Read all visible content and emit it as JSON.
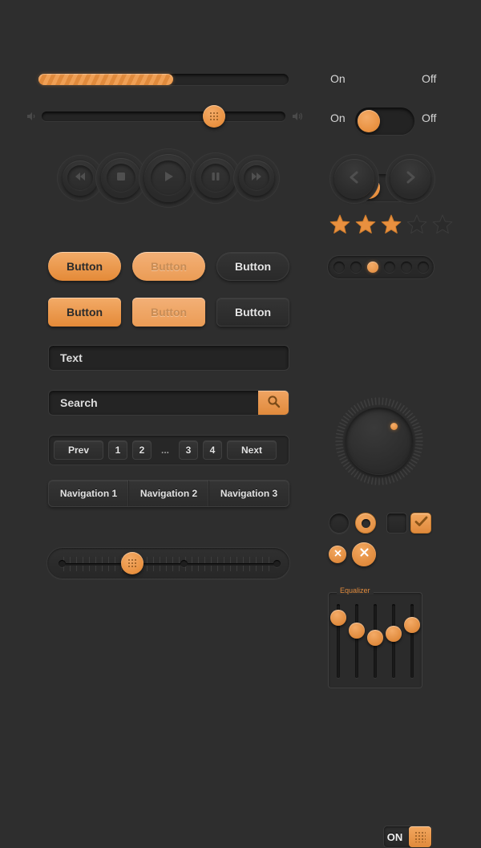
{
  "theme": {
    "background": "#2e2e2e",
    "accent": "#e08a3c",
    "accent_light": "#f3ab68",
    "text": "#d8d8d8",
    "dark_control": "#2a2a2a"
  },
  "progress": {
    "name": "progress-bar",
    "value_percent": 54,
    "striped": true
  },
  "volume_slider": {
    "name": "volume-slider",
    "value_percent": 73,
    "icon_left": "speaker-low-icon",
    "icon_right": "speaker-high-icon"
  },
  "media_controls": {
    "buttons": [
      {
        "name": "rewind-button",
        "icon": "rewind-icon",
        "size": 44
      },
      {
        "name": "stop-button",
        "icon": "stop-icon",
        "size": 50
      },
      {
        "name": "play-button",
        "icon": "play-icon",
        "size": 60
      },
      {
        "name": "pause-button",
        "icon": "pause-icon",
        "size": 50
      },
      {
        "name": "forward-button",
        "icon": "forward-icon",
        "size": 44
      }
    ]
  },
  "buttons": {
    "row1": [
      {
        "name": "button-primary-pill",
        "label": "Button",
        "style": "orange",
        "shape": "pill"
      },
      {
        "name": "button-disabled-pill",
        "label": "Button",
        "style": "orange-disabled",
        "shape": "pill"
      },
      {
        "name": "button-secondary-pill",
        "label": "Button",
        "style": "dark",
        "shape": "pill"
      }
    ],
    "row2": [
      {
        "name": "button-primary-rect",
        "label": "Button",
        "style": "orange",
        "shape": "rect"
      },
      {
        "name": "button-disabled-rect",
        "label": "Button",
        "style": "orange-disabled",
        "shape": "rect"
      },
      {
        "name": "button-secondary-rect",
        "label": "Button",
        "style": "dark",
        "shape": "rect"
      }
    ]
  },
  "text_input": {
    "name": "text-input",
    "value": "Text",
    "placeholder": "Text"
  },
  "search": {
    "name": "search-input",
    "value": "Search",
    "placeholder": "Search",
    "button_icon": "search-icon"
  },
  "pagination": {
    "prev_label": "Prev",
    "next_label": "Next",
    "pages": [
      "1",
      "2",
      "...",
      "3",
      "4"
    ]
  },
  "navigation": {
    "items": [
      {
        "name": "nav-item-1",
        "label": "Navigation 1"
      },
      {
        "name": "nav-item-2",
        "label": "Navigation 2"
      },
      {
        "name": "nav-item-3",
        "label": "Navigation 3"
      }
    ]
  },
  "ruler_slider": {
    "name": "ruler-slider",
    "value_percent": 33,
    "marker_percents": [
      0,
      57,
      100
    ]
  },
  "toggles": [
    {
      "name": "toggle-switch-1",
      "on_label": "On",
      "off_label": "Off",
      "state": "on"
    },
    {
      "name": "toggle-switch-2",
      "on_label": "On",
      "off_label": "Off",
      "state": "on"
    }
  ],
  "arrow_buttons": [
    {
      "name": "previous-arrow-button",
      "icon": "chevron-left-icon"
    },
    {
      "name": "next-arrow-button",
      "icon": "chevron-right-icon"
    }
  ],
  "rating": {
    "name": "star-rating",
    "value": 3,
    "max": 5
  },
  "carousel_dots": {
    "name": "carousel-dots",
    "count": 6,
    "active_index": 2
  },
  "knob": {
    "name": "rotary-knob",
    "indicator_angle_degrees": 45,
    "tick_count": 72
  },
  "equalizer": {
    "legend": "Equalizer",
    "sliders": [
      {
        "name": "eq-slider-1",
        "value_percent": 90
      },
      {
        "name": "eq-slider-2",
        "value_percent": 68
      },
      {
        "name": "eq-slider-3",
        "value_percent": 55
      },
      {
        "name": "eq-slider-4",
        "value_percent": 62
      },
      {
        "name": "eq-slider-5",
        "value_percent": 78
      }
    ]
  },
  "form_controls": {
    "radio_off": {
      "name": "radio-button-unselected",
      "state": "off"
    },
    "radio_on": {
      "name": "radio-button-selected",
      "state": "on"
    },
    "checkbox_off": {
      "name": "checkbox-unchecked",
      "state": "off"
    },
    "checkbox_on": {
      "name": "checkbox-checked",
      "state": "on",
      "icon": "check-icon"
    },
    "close_small": {
      "name": "close-button-small",
      "icon": "close-icon"
    },
    "close_large": {
      "name": "close-button-large",
      "icon": "close-icon"
    },
    "on_toggle": {
      "name": "on-toggle",
      "label": "ON",
      "state": "on"
    }
  }
}
